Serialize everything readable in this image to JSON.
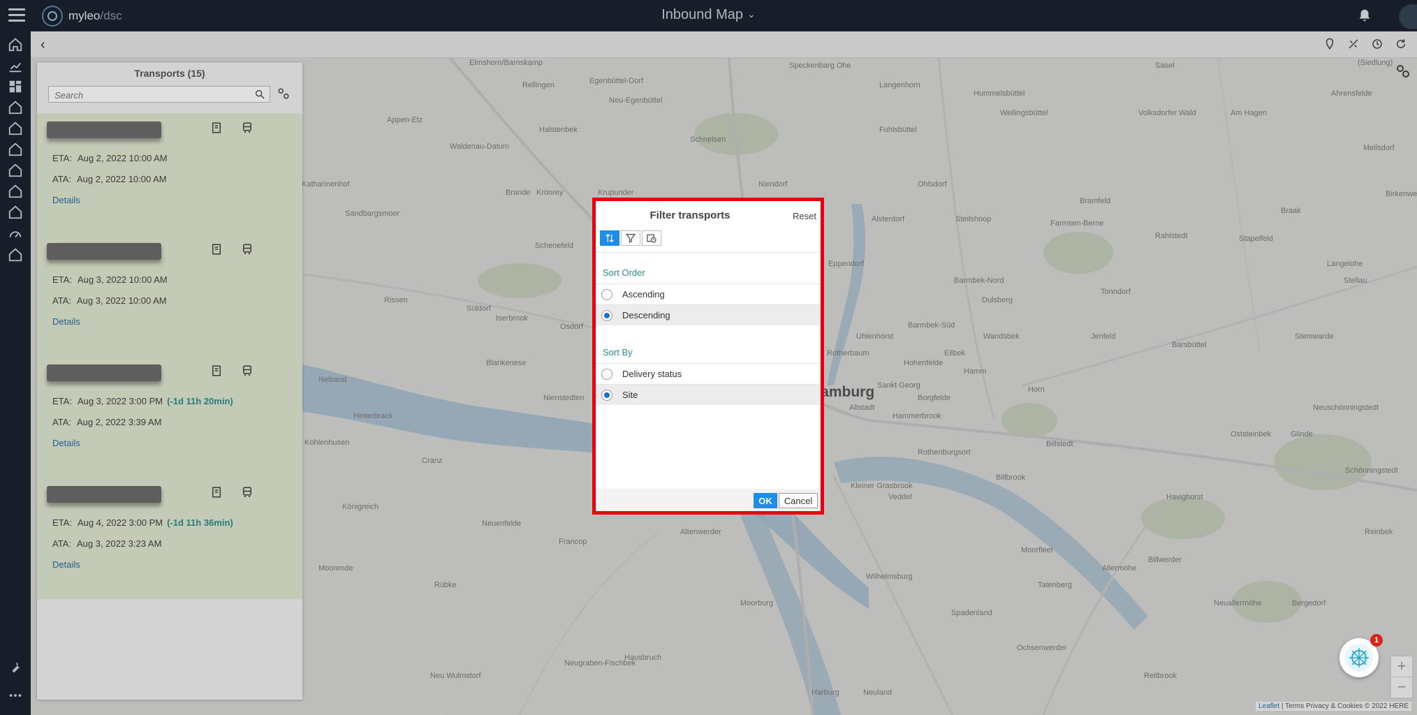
{
  "header": {
    "logo_primary": "myleo",
    "logo_secondary": "/dsc",
    "title": "Inbound Map"
  },
  "rail": {
    "items": [
      "home-icon",
      "chart-satellite-icon",
      "dashboard-icon",
      "home-icon",
      "home-icon",
      "home-icon",
      "home-icon",
      "home-icon",
      "home-icon",
      "gauge-icon",
      "home-icon"
    ],
    "bottom": [
      "wrench-icon",
      "more-icon"
    ]
  },
  "panel": {
    "title": "Transports (15)",
    "search_placeholder": "Search",
    "cards": [
      {
        "eta_label": "ETA:",
        "eta": "Aug 2, 2022 10:00 AM",
        "eta_delta": "",
        "ata_label": "ATA:",
        "ata": "Aug 2, 2022 10:00 AM",
        "details": "Details"
      },
      {
        "eta_label": "ETA:",
        "eta": "Aug 3, 2022 10:00 AM",
        "eta_delta": "",
        "ata_label": "ATA:",
        "ata": "Aug 3, 2022 10:00 AM",
        "details": "Details"
      },
      {
        "eta_label": "ETA:",
        "eta": "Aug 3, 2022 3:00 PM",
        "eta_delta": "(-1d 11h 20min)",
        "ata_label": "ATA:",
        "ata": "Aug 2, 2022 3:39 AM",
        "details": "Details"
      },
      {
        "eta_label": "ETA:",
        "eta": "Aug 4, 2022 3:00 PM",
        "eta_delta": "(-1d 11h 36min)",
        "ata_label": "ATA:",
        "ata": "Aug 3, 2022 3:23 AM",
        "details": "Details"
      }
    ]
  },
  "map": {
    "places": [
      "Elmshorn/Barnskamp",
      "Rellingen",
      "Egenbüttel-Dorf",
      "Neu-Egenbüttel",
      "Speckenbarg Ohe",
      "Langenhorn",
      "Hummelsbüttel",
      "Sasel",
      "(Siedlung)",
      "Ahrensfelde",
      "Appen-Etz",
      "Halstenbek",
      "Schnelsen",
      "Fuhlsbüttel",
      "Wellingsbüttel",
      "Volksdorfer Wald",
      "Am Hagen",
      "Meilsdorf",
      "Waldenau-Datum",
      "Niendorf",
      "Ohlsdorf",
      "Bramfeld",
      "Birkenwerder",
      "Katharinenhof",
      "Brande",
      "Krönrey",
      "Krupunder",
      "Alsterdorf",
      "Steilshoop",
      "Farmsen-Berne",
      "Rahlstedt",
      "Braak",
      "Sandbargsmoor",
      "Schenefeld",
      "Eppendorf",
      "Barmbek-Nord",
      "Stapelfeld",
      "Langelohe",
      "Rissen",
      "Süldorf",
      "Iserbrook",
      "Osdorf",
      "Dulsberg",
      "Tonndorf",
      "Stellau",
      "Barmbek-Süd",
      "Uhlenhorst",
      "Wandsbek",
      "Jenfeld",
      "Stemwarde",
      "Barsbüttel",
      "Blankenese",
      "Rotherbaum",
      "Hohenfelde",
      "Eilbek",
      "Hamm",
      "Horn",
      "Nelsand",
      "Nienstedten",
      "Sankt Georg",
      "Borgfelde",
      "Altstadt",
      "Hammerbrook",
      "Hinterbrack",
      "Kohlenhusen",
      "Oststeinbek",
      "Glinde",
      "Neuschönningstedt",
      "Cranz",
      "Rothenburgsort",
      "Billstedt",
      "Billbrook",
      "Königreich",
      "Neuenfelde",
      "Kleiner Grasbrook",
      "Veddel",
      "Havighorst",
      "Schönningstedt",
      "Francop",
      "Altenwerder",
      "Moorfleet",
      "Allermöhe",
      "Billwerder",
      "Moorende",
      "Rübke",
      "Wilhelmsburg",
      "Tatenberg",
      "Neuallermöhe",
      "Bergedorf",
      "Moorburg",
      "Spadenland",
      "Ochsenwerder",
      "Neugraben-Fischbek",
      "Hausbruch",
      "Neu Wulmstorf",
      "Harburg",
      "Neuland",
      "Reitbrook",
      "Hamburg",
      "Reinbek"
    ],
    "attribution_leaflet": "Leaflet",
    "attribution_rest": "| Terms Privacy & Cookies © 2022 HERE",
    "zoom_in": "+",
    "zoom_out": "−"
  },
  "dialog": {
    "title": "Filter transports",
    "reset": "Reset",
    "tabs": [
      "sort-icon",
      "filter-icon",
      "calendar-clock-icon"
    ],
    "sort_order_label": "Sort Order",
    "sort_order_options": [
      {
        "label": "Ascending",
        "selected": false
      },
      {
        "label": "Descending",
        "selected": true
      }
    ],
    "sort_by_label": "Sort By",
    "sort_by_options": [
      {
        "label": "Delivery status",
        "selected": false
      },
      {
        "label": "Site",
        "selected": true
      }
    ],
    "ok": "OK",
    "cancel": "Cancel"
  },
  "chat": {
    "badge": "1"
  },
  "colors": {
    "topbar": "#1b2330",
    "accent": "#1a8ee8",
    "highlight_border": "#e8000d",
    "teal": "#2c8c8c",
    "link": "#2a6ea8",
    "list_bg": "#dfe6cf"
  }
}
